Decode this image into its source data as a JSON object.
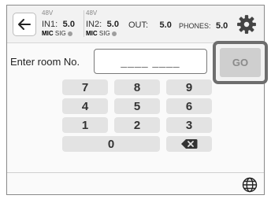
{
  "header": {
    "back_icon": "arrow-left-icon",
    "in1": {
      "phantom": "48V",
      "label": "IN1:",
      "value": "5.0",
      "type": "MIC",
      "sig": "SIG"
    },
    "in2": {
      "phantom": "48V",
      "label": "IN2:",
      "value": "5.0",
      "type": "MIC",
      "sig": "SIG"
    },
    "out": {
      "label": "OUT:",
      "value": "5.0"
    },
    "phones": {
      "label": "PHONES:",
      "value": "5.0"
    },
    "settings_icon": "gear-icon"
  },
  "room": {
    "label": "Enter room No.",
    "placeholder": "____ ____",
    "go_label": "GO"
  },
  "keypad": {
    "keys": [
      "7",
      "8",
      "9",
      "4",
      "5",
      "6",
      "1",
      "2",
      "3",
      "0"
    ],
    "backspace_icon": "backspace-icon"
  },
  "footer": {
    "language_icon": "globe-icon"
  },
  "colors": {
    "key_bg": "#e3e3e3",
    "go_disabled_bg": "#cfcfcf",
    "highlight_border": "#6e6e6e"
  }
}
